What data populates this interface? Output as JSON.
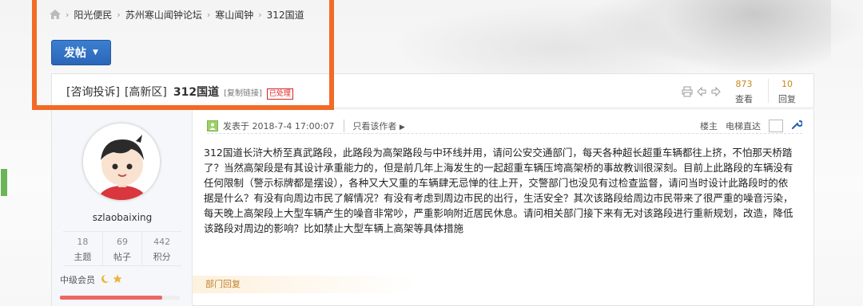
{
  "breadcrumb": [
    "阳光便民",
    "苏州寒山闻钟论坛",
    "寒山闻钟",
    "312国道"
  ],
  "post_button": {
    "label": "发帖"
  },
  "thread": {
    "tag1": "[咨询投诉]",
    "tag2": "[高新区]",
    "title": "312国道",
    "copy_link": "[复制链接]",
    "status": "已处理",
    "views": "873",
    "views_label": "查看",
    "replies": "10",
    "replies_label": "回复"
  },
  "author": {
    "username": "szlaobaixing",
    "stats": [
      {
        "value": "18",
        "label": "主题"
      },
      {
        "value": "69",
        "label": "帖子"
      },
      {
        "value": "442",
        "label": "积分"
      }
    ],
    "rank": "中级会员",
    "rank_progress": 0.85
  },
  "post": {
    "posted": "发表于 2018-7-4 17:00:07",
    "only_author": "只看该作者",
    "floor": "楼主",
    "goto_floor": "电梯直达",
    "body": "312国道长浒大桥至真武路段，此路段为高架路段与中环线并用，请问公安交通部门，每天各种超长超重车辆都往上挤，不怕那天桥踏了？当然高架段是有其设计承重能力的，但是前几年上海发生的一起超重车辆压垮高架桥的事故教训很深刻。目前上此路段的车辆没有任何限制（警示标牌都是摆设），各种又大又重的车辆肆无忌惮的往上开，交警部门也没见有过检查监督，请问当时设计此路段时的依据是什么？有没有向周边市民了解情况？有没有考虑到周边市民的出行，生活安全？其次该路段给周边市民带来了很严重的噪音污染，每天晚上高架段上大型车辆产生的噪音非常吵，严重影响附近居民休息。请问相关部门接下来有无对该路段进行重新规划，改造，降低该路段对周边的影响？比如禁止大型车辆上高架等具体措施",
    "dept_reply": "部门回复"
  },
  "colors": {
    "highlight": "#f26a25",
    "button": "#2a66b8",
    "accent_num": "#c8861b"
  }
}
